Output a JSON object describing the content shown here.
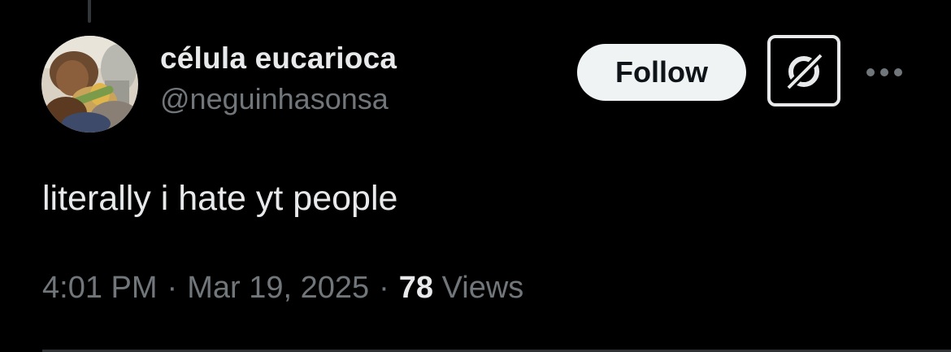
{
  "tweet": {
    "author": {
      "display_name": "célula eucarioca",
      "handle": "@neguinhasonsa",
      "avatar_label": "profile photo"
    },
    "actions": {
      "follow_label": "Follow",
      "grok_icon": "grok-icon",
      "more_icon": "more-icon"
    },
    "text": "literally i hate yt people",
    "meta": {
      "time": "4:01 PM",
      "separator": "·",
      "date": "Mar 19, 2025",
      "views_count": "78",
      "views_label": "Views"
    }
  },
  "colors": {
    "background": "#000000",
    "primary_text": "#e7e9ea",
    "secondary_text": "#71767b",
    "follow_bg": "#eff3f4",
    "follow_text": "#0f1419",
    "divider": "#2f3336"
  }
}
